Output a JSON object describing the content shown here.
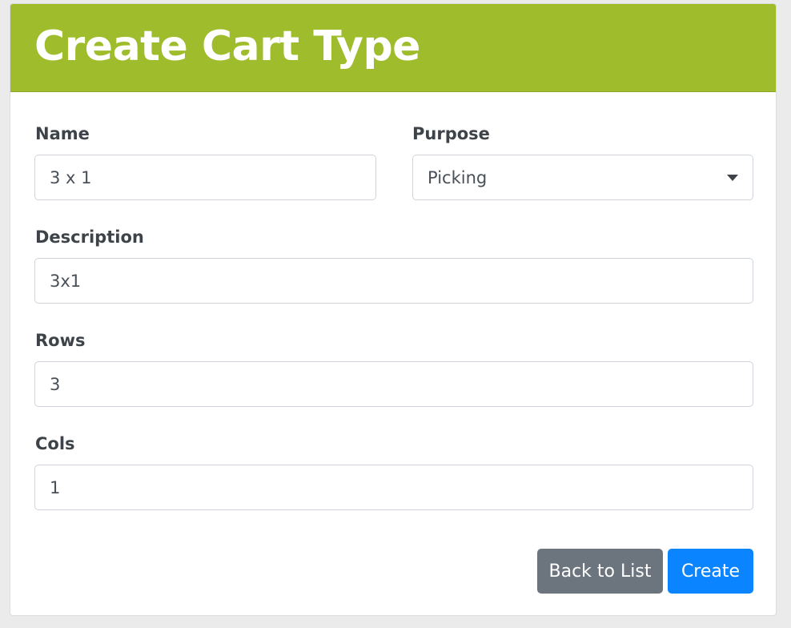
{
  "page": {
    "title": "Create Cart Type"
  },
  "form": {
    "name": {
      "label": "Name",
      "value": "3 x 1"
    },
    "purpose": {
      "label": "Purpose",
      "selected": "Picking"
    },
    "description": {
      "label": "Description",
      "value": "3x1"
    },
    "rows": {
      "label": "Rows",
      "value": "3"
    },
    "cols": {
      "label": "Cols",
      "value": "1"
    }
  },
  "actions": {
    "back_label": "Back to List",
    "create_label": "Create"
  },
  "colors": {
    "header": "#9ebc2b",
    "primary": "#0a84ff",
    "secondary": "#6c757d"
  }
}
